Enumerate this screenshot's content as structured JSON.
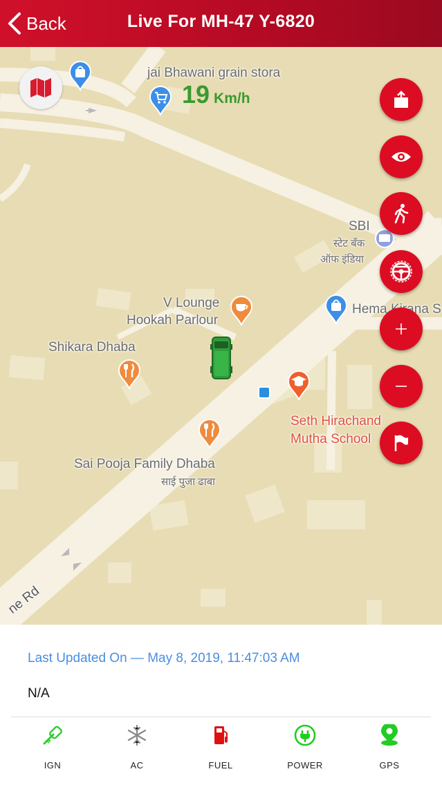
{
  "header": {
    "back_label": "Back",
    "title": "Live For MH-47 Y-6820"
  },
  "map": {
    "speed_value": "19",
    "speed_unit": "Km/h",
    "labels": {
      "jai_bhawani": "jai Bhawani grain stora",
      "sbi": "SBI",
      "sbi_hindi_1": "स्टेट बँक",
      "sbi_hindi_2": "ऑफ इंडिया",
      "hema_kirana": "Hema Kirana S",
      "v_lounge_1": "V Lounge",
      "v_lounge_2": "Hookah Parlour",
      "shikara": "Shikara Dhaba",
      "seth_1": "Seth Hirachand",
      "seth_2": "Mutha School",
      "sai_pooja_1": "Sai Pooja Family Dhaba",
      "sai_pooja_2": "साई पुजा ढाबा",
      "road": "ne Rd"
    },
    "colors": {
      "land": "#e7dcb4",
      "road": "#f6f1e2",
      "accent_red": "#dc0d22",
      "vehicle_green": "#2f9e3a"
    }
  },
  "info": {
    "last_updated": "Last Updated On — May 8, 2019, 11:47:03 AM",
    "address": "N/A"
  },
  "status": [
    {
      "label": "IGN",
      "icon": "ignition-key-icon",
      "color": "#33cc33"
    },
    {
      "label": "AC",
      "icon": "snowflake-icon",
      "color": "#888888"
    },
    {
      "label": "FUEL",
      "icon": "fuel-pump-icon",
      "color": "#e01010"
    },
    {
      "label": "POWER",
      "icon": "power-plug-icon",
      "color": "#22cc22"
    },
    {
      "label": "GPS",
      "icon": "gps-pin-icon",
      "color": "#22cc22"
    }
  ]
}
